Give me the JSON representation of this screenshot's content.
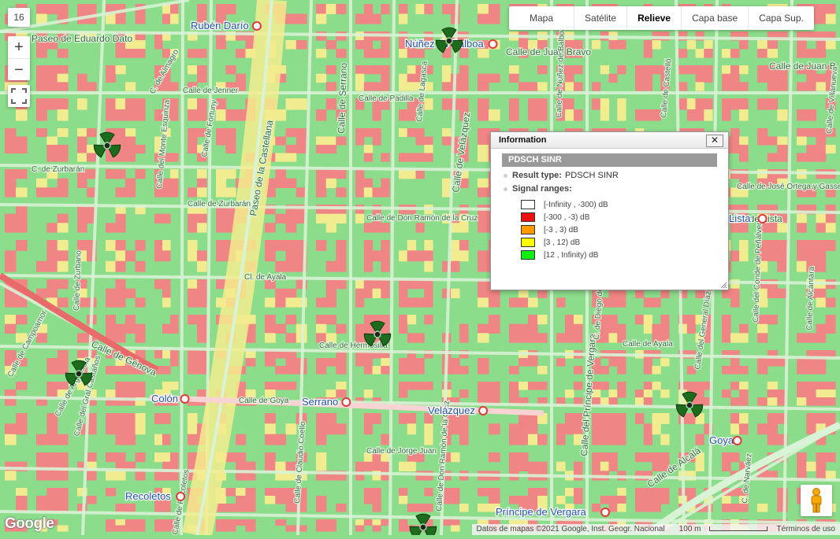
{
  "map": {
    "zoom_level": "16",
    "zoom_in": "+",
    "zoom_out": "−",
    "map_types": [
      "Mapa",
      "Satélite",
      "Relieve",
      "Capa base",
      "Capa Sup."
    ],
    "selected_map_type": "Relieve",
    "streets": [
      "Paseo de Eduardo Dato",
      "Calle de Juan Bravo",
      "Calle de Juan B",
      "C. de Almagro",
      "Calle de Jenner",
      "Calle de Zurbano",
      "Calle del Monte Esquinza",
      "Calle de Fortuny",
      "Paseo de la Castellana",
      "Calle de Serrano",
      "Calle de Padilla",
      "Calle de Lagasca",
      "Calle de Núñez de Balboa",
      "Calle de Castelló",
      "C. de Zurbarán",
      "Calle de Zurbarán",
      "Calle de Don Ramón de la Cruz",
      "Calle de Velázquez",
      "Cl. de Ayala",
      "Calle de Hermosilla",
      "Calle de Génova",
      "Calle de Goya",
      "Calle de Jorge Juan",
      "Calle del Príncipe de Vergara",
      "Calle del General Díaz Porlier",
      "Calle de Alcalá",
      "Calle de José Ortega y Gasset",
      "Calle del Conde de Peñalver",
      "Calle de Alcántara",
      "Calle de Campoamor",
      "Calle de Argensola",
      "Calle del Gral Castaños",
      "C. de Narváez",
      "Calle de Claudio Coello",
      "Calle de Recoletos",
      "Calle de Villanueva",
      "Calle de Lista",
      "C. de Diego de León",
      "Calle de Ayala",
      "Calle de Don Ramón de la Cruz"
    ],
    "stations": [
      "Rubén Darío",
      "Núñez de Balboa",
      "Colón",
      "Serrano",
      "Velázquez",
      "Goya",
      "Recoletos",
      "Príncipe de Vergara",
      "Lista"
    ],
    "colors": {
      "red": "#f08585",
      "yellow": "#f2ec90",
      "green": "#8bdc8b",
      "road": "#d8f3d5"
    }
  },
  "info": {
    "title": "Information",
    "close": "✕",
    "header": "PDSCH SINR",
    "result_type_label": "Result type:",
    "result_type_value": "PDSCH SINR",
    "signal_ranges_label": "Signal ranges:",
    "ranges": [
      {
        "label": "[-Infinity , -300) dB",
        "color": "#ffffff"
      },
      {
        "label": "[-300 , -3) dB",
        "color": "#ee1111"
      },
      {
        "label": "[-3 , 3) dB",
        "color": "#ff9900"
      },
      {
        "label": "[3 , 12) dB",
        "color": "#ffff00"
      },
      {
        "label": "[12 , Infinity) dB",
        "color": "#11ee11"
      }
    ]
  },
  "footer": {
    "logo": "Google",
    "attribution": "Datos de mapas ©2021 Google, Inst. Geogr. Nacional",
    "scale": "100 m",
    "terms": "Términos de uso"
  }
}
